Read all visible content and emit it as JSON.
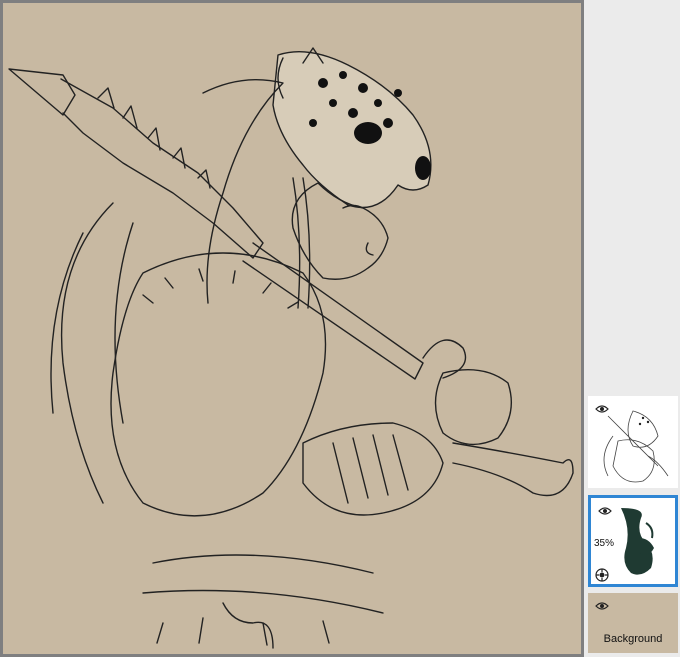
{
  "layers": {
    "items": [
      {
        "name": "",
        "icon": "eye-icon",
        "thumbnail": "line-art-thumbnail"
      },
      {
        "name": "",
        "icon": "eye-icon",
        "opacity": "35%",
        "thumbnail": "shadow-thumbnail",
        "selected": true,
        "clip_icon": "clipping-icon"
      },
      {
        "name": "Background",
        "icon": "eye-icon",
        "color": "#c8b9a2"
      }
    ]
  },
  "colors": {
    "canvas_background": "#c8b9a2",
    "selection_accent": "#2f86d4",
    "shadow_fill": "#1f3a32"
  }
}
